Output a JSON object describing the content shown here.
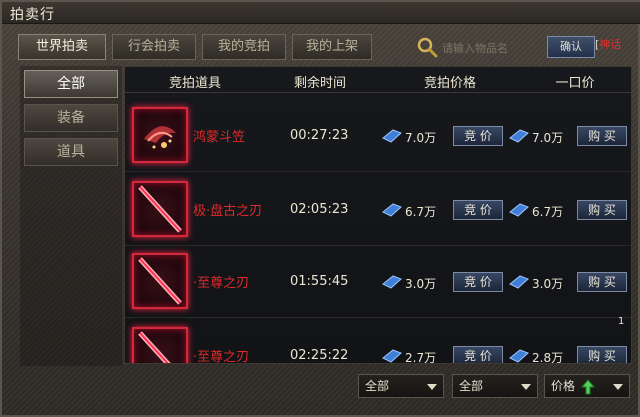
{
  "window": {
    "title": "拍卖行"
  },
  "tabs": [
    {
      "label": "世界拍卖",
      "active": true
    },
    {
      "label": "行会拍卖",
      "active": false
    },
    {
      "label": "我的竞拍",
      "active": false
    },
    {
      "label": "我的上架",
      "active": false
    }
  ],
  "search": {
    "placeholder": "请输入物品名",
    "confirm_label": "确认",
    "watermark_prefix": "[",
    "watermark_text": "神话"
  },
  "sidebar": {
    "items": [
      {
        "label": "全部",
        "active": true
      },
      {
        "label": "装备",
        "active": false
      },
      {
        "label": "道具",
        "active": false
      }
    ]
  },
  "table": {
    "headers": {
      "item": "竞拍道具",
      "time": "剩余时间",
      "bid": "竞拍价格",
      "buyout": "一口价"
    },
    "rows": [
      {
        "name": "鸿蒙斗笠",
        "time": "00:27:23",
        "bid_price": "7.0万",
        "bid_label": "竞 价",
        "buyout_price": "7.0万",
        "buy_label": "购 买",
        "icon": "hat-icon"
      },
      {
        "name": "极·盘古之刃",
        "time": "02:05:23",
        "bid_price": "6.7万",
        "bid_label": "竞 价",
        "buyout_price": "6.7万",
        "buy_label": "购 买",
        "icon": "blade-icon"
      },
      {
        "name": "·至尊之刃",
        "time": "01:55:45",
        "bid_price": "3.0万",
        "bid_label": "竞 价",
        "buyout_price": "3.0万",
        "buy_label": "购 买",
        "icon": "blade-icon"
      },
      {
        "name": "·至尊之刃",
        "time": "02:25:22",
        "bid_price": "2.7万",
        "bid_label": "竞 价",
        "buyout_price": "2.8万",
        "buy_label": "购 买",
        "icon": "blade-icon"
      }
    ]
  },
  "scroll_indicator": "1",
  "footer": {
    "filter1": "全部",
    "filter2": "全部",
    "sort": "价格"
  },
  "colors": {
    "item_name": "#e12a2a",
    "button_blue": "#2a3956",
    "border_red": "#d02a3c"
  }
}
